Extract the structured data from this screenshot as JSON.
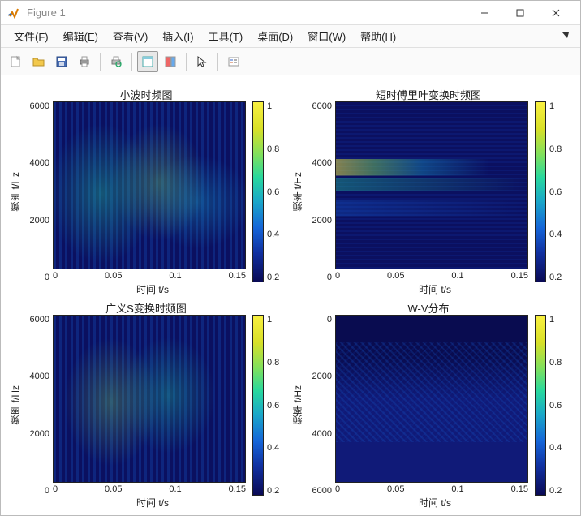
{
  "window": {
    "title": "Figure 1"
  },
  "menu": {
    "file": "文件(F)",
    "edit": "编辑(E)",
    "view": "查看(V)",
    "insert": "插入(I)",
    "tools": "工具(T)",
    "desktop": "桌面(D)",
    "window": "窗口(W)",
    "help": "帮助(H)"
  },
  "chart_data": [
    {
      "type": "heatmap",
      "title": "小波时频图",
      "xlabel": "时间 t/s",
      "ylabel": "频率 f/Hz",
      "xlim": [
        0,
        0.18
      ],
      "ylim": [
        0,
        6000
      ],
      "xticks": [
        "0",
        "0.05",
        "0.1",
        "0.15"
      ],
      "yticks": [
        "6000",
        "4000",
        "2000",
        "0"
      ],
      "colorbar_ticks": [
        "1",
        "0.8",
        "0.6",
        "0.4",
        "0.2"
      ],
      "colormap": "parula",
      "note": "Wavelet time-frequency spectrogram; energy concentrated roughly 1500–4000 Hz across time; normalized magnitude 0–1."
    },
    {
      "type": "heatmap",
      "title": "短时傅里叶变换时频图",
      "xlabel": "时间 t/s",
      "ylabel": "频率 f/Hz",
      "xlim": [
        0,
        0.18
      ],
      "ylim": [
        0,
        6000
      ],
      "xticks": [
        "0",
        "0.05",
        "0.1",
        "0.15"
      ],
      "yticks": [
        "6000",
        "4000",
        "2000",
        "0"
      ],
      "colorbar_ticks": [
        "1",
        "0.8",
        "0.6",
        "0.4",
        "0.2"
      ],
      "colormap": "parula",
      "note": "STFT spectrogram; strong horizontal band near ~3500 Hz, secondary bands ~2500 and ~1500 Hz; normalized magnitude 0–1."
    },
    {
      "type": "heatmap",
      "title": "广义S变换时频图",
      "xlabel": "时间 t/s",
      "ylabel": "频率 f/Hz",
      "xlim": [
        0,
        0.18
      ],
      "ylim": [
        0,
        6000
      ],
      "xticks": [
        "0",
        "0.05",
        "0.1",
        "0.15"
      ],
      "yticks": [
        "6000",
        "4000",
        "2000",
        "0"
      ],
      "colorbar_ticks": [
        "1",
        "0.8",
        "0.6",
        "0.4",
        "0.2"
      ],
      "colormap": "parula",
      "note": "Generalized S-transform spectrogram; similar energy pattern to wavelet, concentrated ~1500–4000 Hz; normalized 0–1."
    },
    {
      "type": "heatmap",
      "title": "W-V分布",
      "xlabel": "时间 t/s",
      "ylabel": "频率 f/Hz",
      "xlim": [
        0,
        0.18
      ],
      "ylim": [
        0,
        6000
      ],
      "xticks": [
        "0",
        "0.05",
        "0.1",
        "0.15"
      ],
      "yticks": [
        "0",
        "2000",
        "4000",
        "6000"
      ],
      "colorbar_ticks": [
        "1",
        "0.8",
        "0.6",
        "0.4",
        "0.2"
      ],
      "colormap": "parula",
      "note": "Wigner-Ville distribution; y-axis reversed (0 top, 6000 bottom); diffuse cross-term interference in mid/lower plot; normalized 0–1."
    }
  ]
}
